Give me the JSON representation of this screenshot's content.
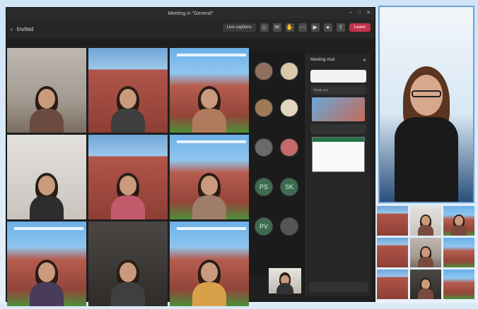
{
  "window": {
    "title": "Meeting in \"General\""
  },
  "toolbar": {
    "back_label": "Invited",
    "live_label": "Live captions",
    "leave_label": "Leave"
  },
  "chat": {
    "title": "Meeting chat",
    "message_text": "Thank you"
  },
  "participants": {
    "initials_1": "PS",
    "initials_2": "SK",
    "initials_3": "PV"
  },
  "colors": {
    "leave": "#c4314b",
    "teams_bg": "#1f1f1f",
    "host_border": "#6a9fd0"
  }
}
